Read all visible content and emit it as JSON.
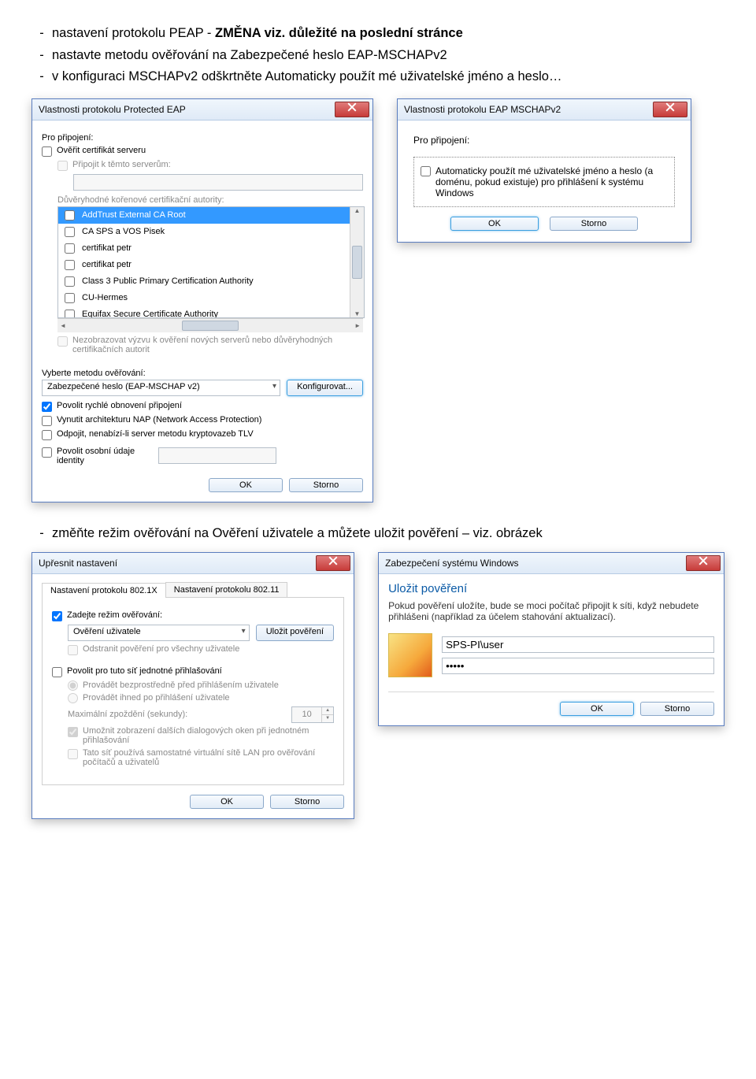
{
  "intro": {
    "line1_pre": "nastavení protokolu PEAP  - ",
    "line1_bold": "ZMĚNA viz. důležité na poslední stránce",
    "line2": "nastavte metodu ověřování na Zabezpečené heslo EAP-MSCHAPv2",
    "line3": "v konfiguraci MSCHAPv2 odškrtněte Automaticky použít mé uživatelské jméno a heslo…"
  },
  "peap": {
    "title": "Vlastnosti protokolu Protected EAP",
    "forconn": "Pro připojení:",
    "verify_cert": "Ověřit certifikát serveru",
    "connect_servers": "Připojit k těmto serverům:",
    "trusted_roots": "Důvěryhodné kořenové certifikační autority:",
    "list": [
      "AddTrust External CA Root",
      "CA SPS a VOS Pisek",
      "certifikat petr",
      "certifikat petr",
      "Class 3 Public Primary Certification Authority",
      "CU-Hermes",
      "Equifax Secure Certificate Authority"
    ],
    "noask": "Nezobrazovat výzvu k ověření nových serverů nebo důvěryhodných certifikačních autorit",
    "select_method": "Vyberte metodu ověřování:",
    "method_value": "Zabezpečené heslo (EAP-MSCHAP v2)",
    "configure": "Konfigurovat...",
    "fast_reconnect": "Povolit rychlé obnovení připojení",
    "enforce_nap": "Vynutit architekturu NAP (Network Access Protection)",
    "disconnect_tlv": "Odpojit, nenabízí-li server metodu kryptovazeb TLV",
    "identity_privacy": "Povolit osobní údaje identity",
    "ok": "OK",
    "cancel": "Storno"
  },
  "mschap": {
    "title": "Vlastnosti protokolu EAP MSCHAPv2",
    "forconn": "Pro připojení:",
    "auto": "Automaticky použít mé uživatelské jméno a heslo (a doménu, pokud existuje) pro přihlášení k systému Windows",
    "ok": "OK",
    "cancel": "Storno"
  },
  "middle": "změňte režim ověřování na Ověření uživatele a můžete uložit pověření – viz. obrázek",
  "adv": {
    "title": "Upřesnit nastavení",
    "tab1": "Nastavení protokolu 802.1X",
    "tab2": "Nastavení protokolu 802.11",
    "specify_mode": "Zadejte režim ověřování:",
    "mode_value": "Ověření uživatele",
    "save_cred": "Uložit pověření",
    "delete_all": "Odstranit pověření pro všechny uživatele",
    "enable_sso": "Povolit pro tuto síť jednotné přihlašování",
    "sso_before": "Provádět bezprostředně před přihlášením uživatele",
    "sso_after": "Provádět ihned po přihlášení uživatele",
    "max_delay": "Maximální zpoždění (sekundy):",
    "max_delay_val": "10",
    "allow_dialogs": "Umožnit zobrazení dalších dialogových oken při jednotném přihlašování",
    "vlan": "Tato síť používá samostatné virtuální sítě LAN pro ověřování počítačů a uživatelů",
    "ok": "OK",
    "cancel": "Storno"
  },
  "cred": {
    "title": "Zabezpečení systému Windows",
    "heading": "Uložit pověření",
    "desc": "Pokud pověření uložíte, bude se moci počítač připojit k síti, když nebudete přihlášeni (například za účelem stahování aktualizací).",
    "user": "SPS-PI\\user",
    "pass": "•••••",
    "ok": "OK",
    "cancel": "Storno"
  }
}
